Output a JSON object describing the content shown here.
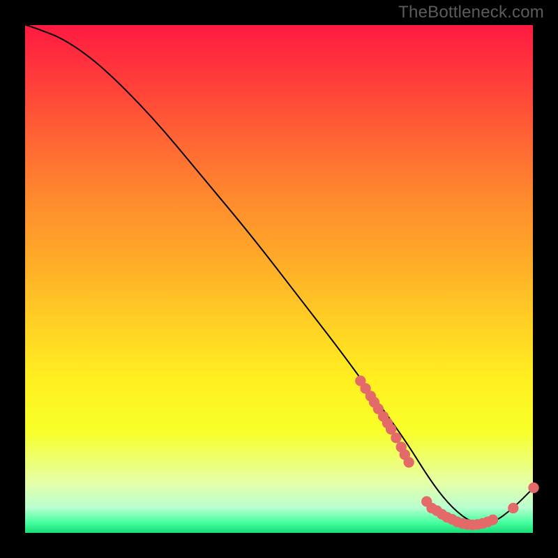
{
  "watermark": "TheBottleneck.com",
  "chart_data": {
    "type": "line",
    "title": "",
    "xlabel": "",
    "ylabel": "",
    "xlim": [
      0,
      100
    ],
    "ylim": [
      0,
      100
    ],
    "series": [
      {
        "name": "curve",
        "x": [
          0,
          3,
          8,
          15,
          25,
          35,
          45,
          55,
          62,
          70,
          75,
          80,
          84,
          88,
          92,
          96,
          100
        ],
        "values": [
          100,
          99,
          97,
          92,
          82,
          70,
          58,
          45,
          36,
          25,
          18,
          10,
          5,
          2,
          2,
          5,
          9
        ]
      }
    ],
    "clusters": [
      {
        "name": "cluster-upper",
        "points": [
          {
            "x": 66,
            "y": 30
          },
          {
            "x": 67,
            "y": 28.5
          },
          {
            "x": 68,
            "y": 27
          },
          {
            "x": 68.7,
            "y": 25.8
          },
          {
            "x": 69.5,
            "y": 24.5
          },
          {
            "x": 70.5,
            "y": 23
          },
          {
            "x": 71.3,
            "y": 21.7
          },
          {
            "x": 72,
            "y": 20.5
          },
          {
            "x": 73,
            "y": 18.8
          },
          {
            "x": 74,
            "y": 17
          },
          {
            "x": 74.7,
            "y": 15.5
          },
          {
            "x": 75.5,
            "y": 14
          }
        ]
      },
      {
        "name": "cluster-lower",
        "points": [
          {
            "x": 79,
            "y": 6.3
          },
          {
            "x": 80,
            "y": 5
          },
          {
            "x": 81,
            "y": 4.5
          },
          {
            "x": 82,
            "y": 3.8
          },
          {
            "x": 83,
            "y": 3.2
          },
          {
            "x": 84,
            "y": 2.8
          },
          {
            "x": 85,
            "y": 2.3
          },
          {
            "x": 86,
            "y": 2
          },
          {
            "x": 87,
            "y": 1.8
          },
          {
            "x": 88,
            "y": 1.7
          },
          {
            "x": 89,
            "y": 1.8
          },
          {
            "x": 90,
            "y": 2
          },
          {
            "x": 91,
            "y": 2.3
          },
          {
            "x": 92,
            "y": 2.7
          },
          {
            "x": 96,
            "y": 5
          },
          {
            "x": 100,
            "y": 9
          }
        ]
      }
    ],
    "marker_color": "#e46a6a",
    "line_color": "#000000"
  }
}
